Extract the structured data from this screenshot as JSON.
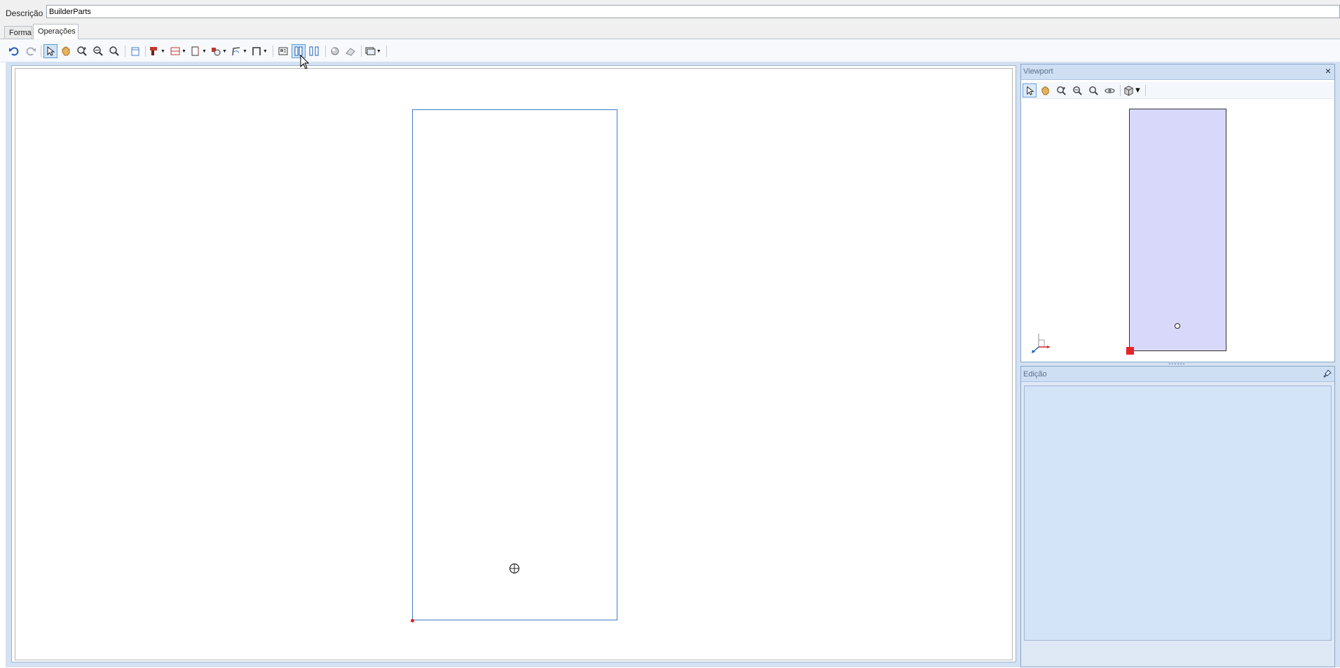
{
  "description": {
    "label": "Descrição",
    "value": "BuilderParts"
  },
  "tabs": [
    {
      "label": "Forma",
      "active": false
    },
    {
      "label": "Operações",
      "active": true
    }
  ],
  "toolbar": {
    "tools": [
      "undo-icon",
      "redo-icon",
      "select-icon",
      "pan-icon",
      "zoom-window-icon",
      "zoom-out-icon",
      "zoom-fit-icon",
      "new-sheet-icon",
      "drill-icon",
      "hatch-icon",
      "frame-icon",
      "machining-icon",
      "path-icon",
      "contour-icon",
      "report-icon",
      "view-columns-icon",
      "view-split-icon",
      "render-icon",
      "eraser-icon",
      "display-mode-icon"
    ],
    "active_tool": "view-columns-icon"
  },
  "viewport_panel": {
    "title": "Viewport",
    "close_glyph": "×",
    "tools": [
      "select-icon",
      "pan-icon",
      "zoom-window-icon",
      "zoom-out-icon",
      "zoom-fit-icon",
      "orbit-icon",
      "view-cube-icon"
    ]
  },
  "edit_panel": {
    "title": "Edição"
  },
  "colors": {
    "accent": "#3c7ec8",
    "panel_bg": "#d3e1f2",
    "part_fill": "#d8d8fa",
    "origin": "#e4242a"
  }
}
